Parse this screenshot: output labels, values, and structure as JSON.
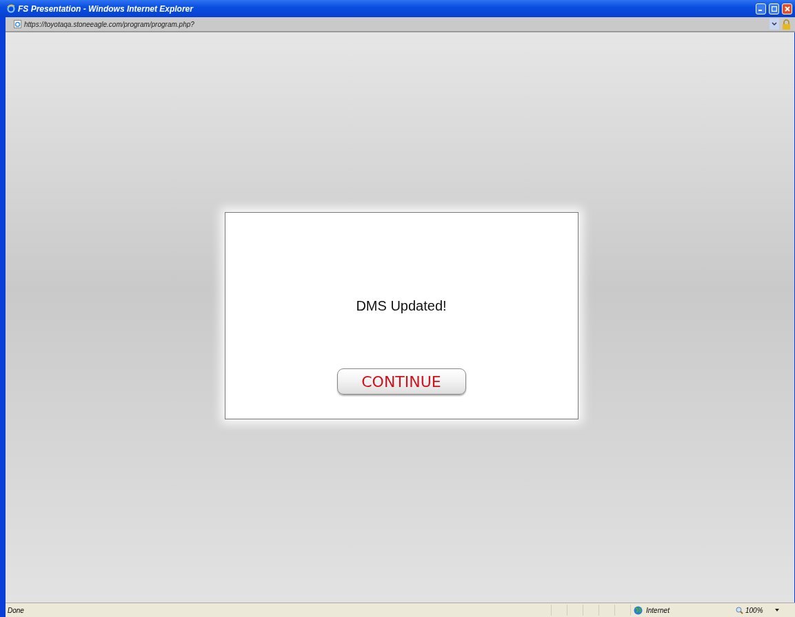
{
  "window": {
    "title": "FS Presentation - Windows Internet Explorer"
  },
  "address_bar": {
    "url": "https://toyotaqa.stoneeagle.com/program/program.php?"
  },
  "dialog": {
    "message": "DMS Updated!",
    "button": "CONTINUE"
  },
  "status_bar": {
    "status": "Done",
    "zone": "Internet",
    "zoom": "100%"
  }
}
